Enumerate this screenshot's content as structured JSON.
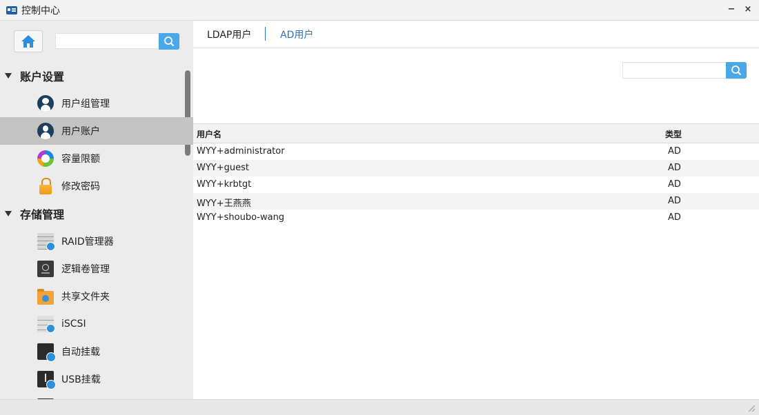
{
  "window": {
    "title": "控制中心",
    "minimize": "−",
    "close": "×"
  },
  "sidebar": {
    "search_placeholder": "",
    "sections": [
      {
        "title": "账户设置",
        "items": [
          {
            "label": "用户组管理",
            "icon": "user-group-icon"
          },
          {
            "label": "用户账户",
            "icon": "user-account-icon",
            "selected": true
          },
          {
            "label": "容量限额",
            "icon": "quota-icon"
          },
          {
            "label": "修改密码",
            "icon": "lock-icon"
          }
        ]
      },
      {
        "title": "存储管理",
        "items": [
          {
            "label": "RAID管理器",
            "icon": "raid-icon"
          },
          {
            "label": "逻辑卷管理",
            "icon": "lvm-icon"
          },
          {
            "label": "共享文件夹",
            "icon": "shared-folder-icon"
          },
          {
            "label": "iSCSI",
            "icon": "iscsi-icon"
          },
          {
            "label": "自动挂载",
            "icon": "auto-mount-icon"
          },
          {
            "label": "USB挂载",
            "icon": "usb-mount-icon"
          }
        ]
      }
    ]
  },
  "tabs": [
    {
      "label": "LDAP用户",
      "active": false
    },
    {
      "label": "AD用户",
      "active": true
    }
  ],
  "search": {
    "placeholder": ""
  },
  "table": {
    "columns": [
      "用户名",
      "类型"
    ],
    "rows": [
      [
        "WYY+administrator",
        "AD"
      ],
      [
        "WYY+guest",
        "AD"
      ],
      [
        "WYY+krbtgt",
        "AD"
      ],
      [
        "WYY+王燕燕",
        "AD"
      ],
      [
        "WYY+shoubo-wang",
        "AD"
      ]
    ]
  },
  "colors": {
    "accent": "#4aa8e8",
    "tab_link": "#2a73c2",
    "selected_row": "#c3c3c3"
  }
}
